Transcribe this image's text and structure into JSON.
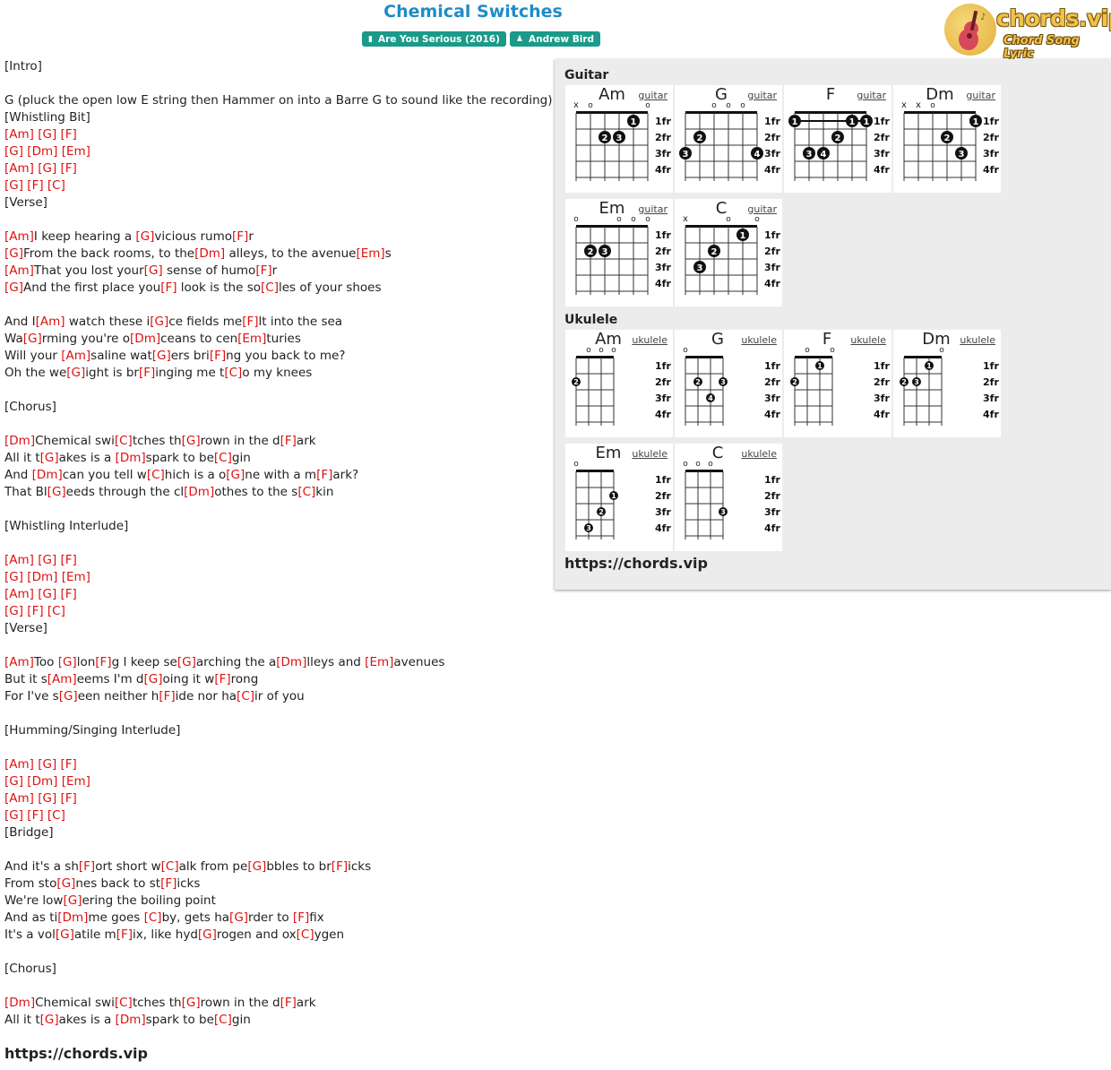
{
  "title": "Chemical Switches",
  "tags": [
    {
      "icon": "album-icon",
      "label": "Are You Serious (2016)"
    },
    {
      "icon": "artist-icon",
      "label": "Andrew Bird"
    }
  ],
  "logo": {
    "wordmark": "chords.vip",
    "tagline": "Chord Song Lyric"
  },
  "lyrics": [
    [
      {
        "t": "[Intro]"
      }
    ],
    [],
    [
      {
        "t": "G (pluck the open low E string then Hammer on into a Barre G to sound like the recording)"
      }
    ],
    [
      {
        "t": "[Whistling Bit]"
      }
    ],
    [
      {
        "c": "[Am]"
      },
      {
        "t": " "
      },
      {
        "c": "[G]"
      },
      {
        "t": " "
      },
      {
        "c": "[F]"
      }
    ],
    [
      {
        "c": "[G]"
      },
      {
        "t": " "
      },
      {
        "c": "[Dm]"
      },
      {
        "t": " "
      },
      {
        "c": "[Em]"
      }
    ],
    [
      {
        "c": "[Am]"
      },
      {
        "t": " "
      },
      {
        "c": "[G]"
      },
      {
        "t": " "
      },
      {
        "c": "[F]"
      }
    ],
    [
      {
        "c": "[G]"
      },
      {
        "t": " "
      },
      {
        "c": "[F]"
      },
      {
        "t": " "
      },
      {
        "c": "[C]"
      }
    ],
    [
      {
        "t": "[Verse]"
      }
    ],
    [],
    [
      {
        "c": "[Am]"
      },
      {
        "t": "I keep hearing a "
      },
      {
        "c": "[G]"
      },
      {
        "t": "vicious rumo"
      },
      {
        "c": "[F]"
      },
      {
        "t": "r"
      }
    ],
    [
      {
        "c": "[G]"
      },
      {
        "t": "From the back rooms, to the"
      },
      {
        "c": "[Dm]"
      },
      {
        "t": " alleys, to the avenue"
      },
      {
        "c": "[Em]"
      },
      {
        "t": "s"
      }
    ],
    [
      {
        "c": "[Am]"
      },
      {
        "t": "That you lost your"
      },
      {
        "c": "[G]"
      },
      {
        "t": " sense of humo"
      },
      {
        "c": "[F]"
      },
      {
        "t": "r"
      }
    ],
    [
      {
        "c": "[G]"
      },
      {
        "t": "And the first place you"
      },
      {
        "c": "[F]"
      },
      {
        "t": " look is the so"
      },
      {
        "c": "[C]"
      },
      {
        "t": "les of your shoes"
      }
    ],
    [],
    [
      {
        "t": "And I"
      },
      {
        "c": "[Am]"
      },
      {
        "t": " watch these i"
      },
      {
        "c": "[G]"
      },
      {
        "t": "ce fields me"
      },
      {
        "c": "[F]"
      },
      {
        "t": "lt into the sea"
      }
    ],
    [
      {
        "t": "Wa"
      },
      {
        "c": "[G]"
      },
      {
        "t": "rming you're o"
      },
      {
        "c": "[Dm]"
      },
      {
        "t": "ceans to cen"
      },
      {
        "c": "[Em]"
      },
      {
        "t": "turies"
      }
    ],
    [
      {
        "t": "Will your "
      },
      {
        "c": "[Am]"
      },
      {
        "t": "saline wat"
      },
      {
        "c": "[G]"
      },
      {
        "t": "ers bri"
      },
      {
        "c": "[F]"
      },
      {
        "t": "ng you back to me?"
      }
    ],
    [
      {
        "t": "Oh the we"
      },
      {
        "c": "[G]"
      },
      {
        "t": "ight is br"
      },
      {
        "c": "[F]"
      },
      {
        "t": "inging me t"
      },
      {
        "c": "[C]"
      },
      {
        "t": "o my knees"
      }
    ],
    [],
    [
      {
        "t": "[Chorus]"
      }
    ],
    [],
    [
      {
        "c": "[Dm]"
      },
      {
        "t": "Chemical swi"
      },
      {
        "c": "[C]"
      },
      {
        "t": "tches th"
      },
      {
        "c": "[G]"
      },
      {
        "t": "rown in the d"
      },
      {
        "c": "[F]"
      },
      {
        "t": "ark"
      }
    ],
    [
      {
        "t": "All it t"
      },
      {
        "c": "[G]"
      },
      {
        "t": "akes is a "
      },
      {
        "c": "[Dm]"
      },
      {
        "t": "spark to be"
      },
      {
        "c": "[C]"
      },
      {
        "t": "gin"
      }
    ],
    [
      {
        "t": "And "
      },
      {
        "c": "[Dm]"
      },
      {
        "t": "can you tell w"
      },
      {
        "c": "[C]"
      },
      {
        "t": "hich is a o"
      },
      {
        "c": "[G]"
      },
      {
        "t": "ne with a m"
      },
      {
        "c": "[F]"
      },
      {
        "t": "ark?"
      }
    ],
    [
      {
        "t": "That Bl"
      },
      {
        "c": "[G]"
      },
      {
        "t": "eeds through the cl"
      },
      {
        "c": "[Dm]"
      },
      {
        "t": "othes to the s"
      },
      {
        "c": "[C]"
      },
      {
        "t": "kin"
      }
    ],
    [],
    [
      {
        "t": "[Whistling Interlude]"
      }
    ],
    [],
    [
      {
        "c": "[Am]"
      },
      {
        "t": " "
      },
      {
        "c": "[G]"
      },
      {
        "t": " "
      },
      {
        "c": "[F]"
      }
    ],
    [
      {
        "c": "[G]"
      },
      {
        "t": " "
      },
      {
        "c": "[Dm]"
      },
      {
        "t": " "
      },
      {
        "c": "[Em]"
      }
    ],
    [
      {
        "c": "[Am]"
      },
      {
        "t": " "
      },
      {
        "c": "[G]"
      },
      {
        "t": " "
      },
      {
        "c": "[F]"
      }
    ],
    [
      {
        "c": "[G]"
      },
      {
        "t": " "
      },
      {
        "c": "[F]"
      },
      {
        "t": " "
      },
      {
        "c": "[C]"
      }
    ],
    [
      {
        "t": "[Verse]"
      }
    ],
    [],
    [
      {
        "c": "[Am]"
      },
      {
        "t": "Too "
      },
      {
        "c": "[G]"
      },
      {
        "t": "lon"
      },
      {
        "c": "[F]"
      },
      {
        "t": "g I keep se"
      },
      {
        "c": "[G]"
      },
      {
        "t": "arching the a"
      },
      {
        "c": "[Dm]"
      },
      {
        "t": "lleys and "
      },
      {
        "c": "[Em]"
      },
      {
        "t": "avenues"
      }
    ],
    [
      {
        "t": "But it s"
      },
      {
        "c": "[Am]"
      },
      {
        "t": "eems I'm d"
      },
      {
        "c": "[G]"
      },
      {
        "t": "oing it w"
      },
      {
        "c": "[F]"
      },
      {
        "t": "rong"
      }
    ],
    [
      {
        "t": "For I've s"
      },
      {
        "c": "[G]"
      },
      {
        "t": "een neither h"
      },
      {
        "c": "[F]"
      },
      {
        "t": "ide nor ha"
      },
      {
        "c": "[C]"
      },
      {
        "t": "ir of you"
      }
    ],
    [],
    [
      {
        "t": "[Humming/Singing Interlude]"
      }
    ],
    [],
    [
      {
        "c": "[Am]"
      },
      {
        "t": " "
      },
      {
        "c": "[G]"
      },
      {
        "t": " "
      },
      {
        "c": "[F]"
      }
    ],
    [
      {
        "c": "[G]"
      },
      {
        "t": " "
      },
      {
        "c": "[Dm]"
      },
      {
        "t": " "
      },
      {
        "c": "[Em]"
      }
    ],
    [
      {
        "c": "[Am]"
      },
      {
        "t": " "
      },
      {
        "c": "[G]"
      },
      {
        "t": " "
      },
      {
        "c": "[F]"
      }
    ],
    [
      {
        "c": "[G]"
      },
      {
        "t": " "
      },
      {
        "c": "[F]"
      },
      {
        "t": " "
      },
      {
        "c": "[C]"
      }
    ],
    [
      {
        "t": "[Bridge]"
      }
    ],
    [],
    [
      {
        "t": "And it's a sh"
      },
      {
        "c": "[F]"
      },
      {
        "t": "ort short w"
      },
      {
        "c": "[C]"
      },
      {
        "t": "alk from pe"
      },
      {
        "c": "[G]"
      },
      {
        "t": "bbles to br"
      },
      {
        "c": "[F]"
      },
      {
        "t": "icks"
      }
    ],
    [
      {
        "t": "From sto"
      },
      {
        "c": "[G]"
      },
      {
        "t": "nes back to st"
      },
      {
        "c": "[F]"
      },
      {
        "t": "icks"
      }
    ],
    [
      {
        "t": "We're low"
      },
      {
        "c": "[G]"
      },
      {
        "t": "ering the boiling point"
      }
    ],
    [
      {
        "t": "And as ti"
      },
      {
        "c": "[Dm]"
      },
      {
        "t": "me goes "
      },
      {
        "c": "[C]"
      },
      {
        "t": "by, gets ha"
      },
      {
        "c": "[G]"
      },
      {
        "t": "rder to "
      },
      {
        "c": "[F]"
      },
      {
        "t": "fix"
      }
    ],
    [
      {
        "t": "It's a vol"
      },
      {
        "c": "[G]"
      },
      {
        "t": "atile m"
      },
      {
        "c": "[F]"
      },
      {
        "t": "ix, like hyd"
      },
      {
        "c": "[G]"
      },
      {
        "t": "rogen and ox"
      },
      {
        "c": "[C]"
      },
      {
        "t": "ygen"
      }
    ],
    [],
    [
      {
        "t": "[Chorus]"
      }
    ],
    [],
    [
      {
        "c": "[Dm]"
      },
      {
        "t": "Chemical swi"
      },
      {
        "c": "[C]"
      },
      {
        "t": "tches th"
      },
      {
        "c": "[G]"
      },
      {
        "t": "rown in the d"
      },
      {
        "c": "[F]"
      },
      {
        "t": "ark"
      }
    ],
    [
      {
        "t": "All it t"
      },
      {
        "c": "[G]"
      },
      {
        "t": "akes is a "
      },
      {
        "c": "[Dm]"
      },
      {
        "t": "spark to be"
      },
      {
        "c": "[C]"
      },
      {
        "t": "gin"
      }
    ]
  ],
  "footer_url": "https://chords.vip",
  "panel": {
    "guitar_title": "Guitar",
    "ukulele_title": "Ukulele",
    "url": "https://chords.vip",
    "fret_labels": [
      "1fr",
      "2fr",
      "3fr",
      "4fr"
    ],
    "guitar": [
      {
        "name": "Am",
        "link": "guitar",
        "open": [
          "x",
          "o",
          "",
          "",
          "",
          "o"
        ],
        "dots": [
          {
            "s": 5,
            "f": 1,
            "n": "1"
          },
          {
            "s": 3,
            "f": 2,
            "n": "2"
          },
          {
            "s": 4,
            "f": 2,
            "n": "3"
          }
        ],
        "barre": null
      },
      {
        "name": "G",
        "link": "guitar",
        "open": [
          "",
          "",
          "o",
          "o",
          "o",
          ""
        ],
        "dots": [
          {
            "s": 2,
            "f": 2,
            "n": "2"
          },
          {
            "s": 1,
            "f": 3,
            "n": "3"
          },
          {
            "s": 6,
            "f": 3,
            "n": "4"
          }
        ],
        "barre": null
      },
      {
        "name": "F",
        "link": "guitar",
        "open": [
          "",
          "",
          "",
          "",
          "",
          ""
        ],
        "dots": [
          {
            "s": 1,
            "f": 1,
            "n": "1"
          },
          {
            "s": 5,
            "f": 1,
            "n": "1"
          },
          {
            "s": 6,
            "f": 1,
            "n": "1"
          },
          {
            "s": 4,
            "f": 2,
            "n": "2"
          },
          {
            "s": 2,
            "f": 3,
            "n": "3"
          },
          {
            "s": 3,
            "f": 3,
            "n": "4"
          }
        ],
        "barre": {
          "f": 1,
          "from": 1,
          "to": 6
        }
      },
      {
        "name": "Dm",
        "link": "guitar",
        "open": [
          "x",
          "x",
          "o",
          "",
          "",
          ""
        ],
        "dots": [
          {
            "s": 6,
            "f": 1,
            "n": "1"
          },
          {
            "s": 4,
            "f": 2,
            "n": "2"
          },
          {
            "s": 5,
            "f": 3,
            "n": "3"
          }
        ],
        "barre": null
      },
      {
        "name": "Em",
        "link": "guitar",
        "open": [
          "o",
          "",
          "",
          "o",
          "o",
          "o"
        ],
        "dots": [
          {
            "s": 2,
            "f": 2,
            "n": "2"
          },
          {
            "s": 3,
            "f": 2,
            "n": "3"
          }
        ],
        "barre": null
      },
      {
        "name": "C",
        "link": "guitar",
        "open": [
          "x",
          "",
          "",
          "o",
          "",
          "o"
        ],
        "dots": [
          {
            "s": 5,
            "f": 1,
            "n": "1"
          },
          {
            "s": 3,
            "f": 2,
            "n": "2"
          },
          {
            "s": 2,
            "f": 3,
            "n": "3"
          }
        ],
        "barre": null
      }
    ],
    "ukulele": [
      {
        "name": "Am",
        "link": "ukulele",
        "open": [
          "",
          "o",
          "o",
          "o"
        ],
        "dots": [
          {
            "s": 1,
            "f": 2,
            "n": "2"
          }
        ],
        "barre": null
      },
      {
        "name": "G",
        "link": "ukulele",
        "open": [
          "o",
          "",
          "",
          ""
        ],
        "dots": [
          {
            "s": 2,
            "f": 2,
            "n": "2"
          },
          {
            "s": 4,
            "f": 2,
            "n": "3"
          },
          {
            "s": 3,
            "f": 3,
            "n": "4"
          }
        ],
        "barre": null
      },
      {
        "name": "F",
        "link": "ukulele",
        "open": [
          "",
          "o",
          "",
          "o"
        ],
        "dots": [
          {
            "s": 3,
            "f": 1,
            "n": "1"
          },
          {
            "s": 1,
            "f": 2,
            "n": "2"
          }
        ],
        "barre": null
      },
      {
        "name": "Dm",
        "link": "ukulele",
        "open": [
          "",
          "",
          "",
          "o"
        ],
        "dots": [
          {
            "s": 3,
            "f": 1,
            "n": "1"
          },
          {
            "s": 1,
            "f": 2,
            "n": "2"
          },
          {
            "s": 2,
            "f": 2,
            "n": "3"
          }
        ],
        "barre": null
      },
      {
        "name": "Em",
        "link": "ukulele",
        "open": [
          "o",
          "",
          "",
          ""
        ],
        "dots": [
          {
            "s": 4,
            "f": 2,
            "n": "1"
          },
          {
            "s": 3,
            "f": 3,
            "n": "2"
          },
          {
            "s": 2,
            "f": 4,
            "n": "3"
          }
        ],
        "barre": null
      },
      {
        "name": "C",
        "link": "ukulele",
        "open": [
          "o",
          "o",
          "o",
          ""
        ],
        "dots": [
          {
            "s": 4,
            "f": 3,
            "n": "3"
          }
        ],
        "barre": null
      }
    ]
  }
}
